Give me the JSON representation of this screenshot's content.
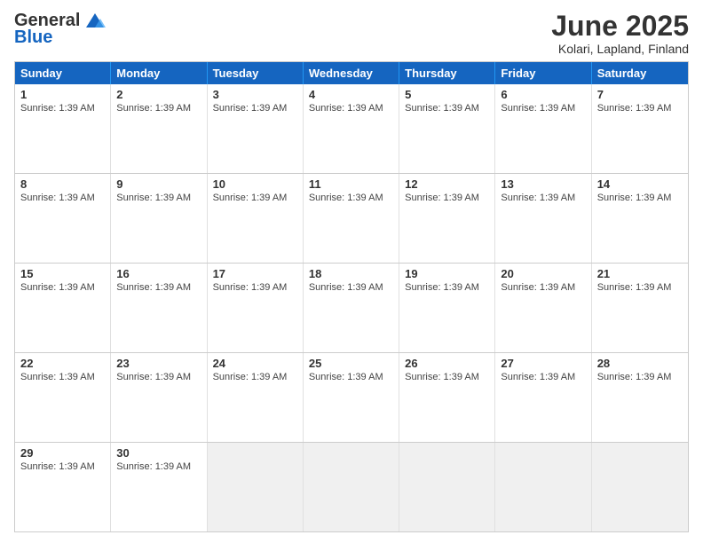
{
  "logo": {
    "line1": "General",
    "line2": "Blue"
  },
  "title": {
    "month_year": "June 2025",
    "location": "Kolari, Lapland, Finland"
  },
  "days_header": [
    "Sunday",
    "Monday",
    "Tuesday",
    "Wednesday",
    "Thursday",
    "Friday",
    "Saturday"
  ],
  "sunrise_text": "Sunrise: 1:39 AM",
  "weeks": [
    [
      {
        "day": "1",
        "sunrise": "Sunrise: 1:39 AM"
      },
      {
        "day": "2",
        "sunrise": "Sunrise: 1:39 AM"
      },
      {
        "day": "3",
        "sunrise": "Sunrise: 1:39 AM"
      },
      {
        "day": "4",
        "sunrise": "Sunrise: 1:39 AM"
      },
      {
        "day": "5",
        "sunrise": "Sunrise: 1:39 AM"
      },
      {
        "day": "6",
        "sunrise": "Sunrise: 1:39 AM"
      },
      {
        "day": "7",
        "sunrise": "Sunrise: 1:39 AM"
      }
    ],
    [
      {
        "day": "8",
        "sunrise": "Sunrise: 1:39 AM"
      },
      {
        "day": "9",
        "sunrise": "Sunrise: 1:39 AM"
      },
      {
        "day": "10",
        "sunrise": "Sunrise: 1:39 AM"
      },
      {
        "day": "11",
        "sunrise": "Sunrise: 1:39 AM"
      },
      {
        "day": "12",
        "sunrise": "Sunrise: 1:39 AM"
      },
      {
        "day": "13",
        "sunrise": "Sunrise: 1:39 AM"
      },
      {
        "day": "14",
        "sunrise": "Sunrise: 1:39 AM"
      }
    ],
    [
      {
        "day": "15",
        "sunrise": "Sunrise: 1:39 AM"
      },
      {
        "day": "16",
        "sunrise": "Sunrise: 1:39 AM"
      },
      {
        "day": "17",
        "sunrise": "Sunrise: 1:39 AM"
      },
      {
        "day": "18",
        "sunrise": "Sunrise: 1:39 AM"
      },
      {
        "day": "19",
        "sunrise": "Sunrise: 1:39 AM"
      },
      {
        "day": "20",
        "sunrise": "Sunrise: 1:39 AM"
      },
      {
        "day": "21",
        "sunrise": "Sunrise: 1:39 AM"
      }
    ],
    [
      {
        "day": "22",
        "sunrise": "Sunrise: 1:39 AM"
      },
      {
        "day": "23",
        "sunrise": "Sunrise: 1:39 AM"
      },
      {
        "day": "24",
        "sunrise": "Sunrise: 1:39 AM"
      },
      {
        "day": "25",
        "sunrise": "Sunrise: 1:39 AM"
      },
      {
        "day": "26",
        "sunrise": "Sunrise: 1:39 AM"
      },
      {
        "day": "27",
        "sunrise": "Sunrise: 1:39 AM"
      },
      {
        "day": "28",
        "sunrise": "Sunrise: 1:39 AM"
      }
    ],
    [
      {
        "day": "29",
        "sunrise": "Sunrise: 1:39 AM"
      },
      {
        "day": "30",
        "sunrise": "Sunrise: 1:39 AM"
      },
      null,
      null,
      null,
      null,
      null
    ]
  ]
}
